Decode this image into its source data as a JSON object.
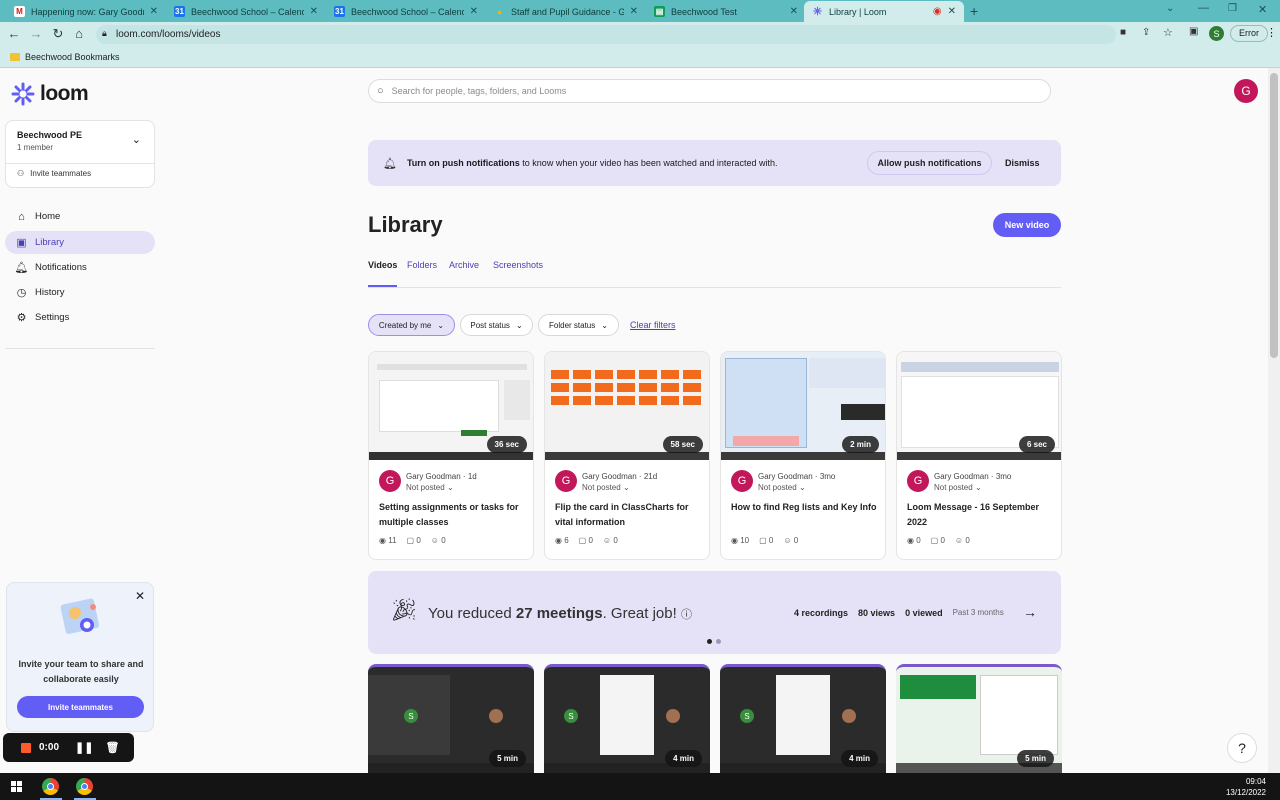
{
  "browser": {
    "tabs": [
      {
        "title": "Happening now: Gary Goodman",
        "fav_color": "#c5221f",
        "fav": "M"
      },
      {
        "title": "Beechwood School – Calendar",
        "fav_color": "#1a73e8",
        "fav": "31"
      },
      {
        "title": "Beechwood School – Calendar",
        "fav_color": "#1a73e8",
        "fav": "31"
      },
      {
        "title": "Staff and Pupil Guidance - Goog",
        "fav_color": "#f4b400",
        "fav": "▲"
      },
      {
        "title": "Beechwood Test",
        "fav_color": "#0f9d58",
        "fav": "▤"
      },
      {
        "title": "Library | Loom",
        "fav_color": "#625df5",
        "fav": "✳"
      }
    ],
    "url": "loom.com/looms/videos",
    "error_label": "Error",
    "profile_letter": "S",
    "bookmark": "Beechwood Bookmarks"
  },
  "sidebar": {
    "logo": "loom",
    "workspace_name": "Beechwood PE",
    "workspace_members": "1 member",
    "invite": "Invite teammates",
    "nav": [
      {
        "label": "Home",
        "icon": "home-icon"
      },
      {
        "label": "Library",
        "icon": "library-icon"
      },
      {
        "label": "Notifications",
        "icon": "bell-icon"
      },
      {
        "label": "History",
        "icon": "clock-icon"
      },
      {
        "label": "Settings",
        "icon": "gear-icon"
      }
    ],
    "promo_text": "Invite your team to share and collaborate easily",
    "promo_button": "Invite teammates"
  },
  "main": {
    "search_placeholder": "Search for people, tags, folders, and Looms",
    "avatar_letter": "G",
    "notification_bold": "Turn on push notifications",
    "notification_rest": " to know when your video has been watched and interacted with.",
    "allow_button": "Allow push notifications",
    "dismiss_button": "Dismiss",
    "title": "Library",
    "new_video": "New video",
    "tabs": [
      "Videos",
      "Folders",
      "Archive",
      "Screenshots"
    ],
    "filters": [
      "Created by me",
      "Post status",
      "Folder status"
    ],
    "clear_filters": "Clear filters",
    "cards": [
      {
        "duration": "36 sec",
        "author": "Gary Goodman",
        "age": "1d",
        "status": "Not posted",
        "title": "Setting assignments or tasks for multiple classes",
        "views": "11",
        "comments": "0",
        "reactions": "0"
      },
      {
        "duration": "58 sec",
        "author": "Gary Goodman",
        "age": "21d",
        "status": "Not posted",
        "title": "Flip the card in ClassCharts for vital information",
        "views": "6",
        "comments": "0",
        "reactions": "0"
      },
      {
        "duration": "2 min",
        "author": "Gary Goodman",
        "age": "3mo",
        "status": "Not posted",
        "title": "How to find Reg lists and Key Info",
        "views": "10",
        "comments": "0",
        "reactions": "0"
      },
      {
        "duration": "6 sec",
        "author": "Gary Goodman",
        "age": "3mo",
        "status": "Not posted",
        "title": "Loom Message - 16 September 2022",
        "views": "0",
        "comments": "0",
        "reactions": "0"
      }
    ],
    "banner": {
      "prefix": "You reduced ",
      "count": "27 meetings",
      "suffix": ". Great job!",
      "recordings": "4 recordings",
      "views": "80 views",
      "viewed": "0 viewed",
      "period": "Past 3 months"
    },
    "cards2": [
      {
        "duration": "5 min"
      },
      {
        "duration": "4 min"
      },
      {
        "duration": "4 min"
      },
      {
        "duration": "5 min"
      }
    ],
    "help": "?"
  },
  "recorder": {
    "time": "0:00"
  },
  "taskbar": {
    "time": "09:04",
    "date": "13/12/2022"
  }
}
